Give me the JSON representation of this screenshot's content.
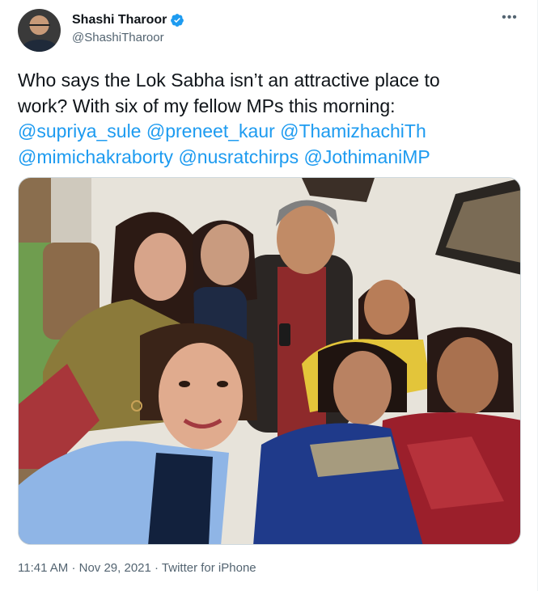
{
  "author": {
    "display_name": "Shashi Tharoor",
    "handle": "@ShashiTharoor",
    "verified": true
  },
  "tweet": {
    "text_lines": [
      "Who says the Lok Sabha isn’t an attractive place to",
      "work? With six of my fellow MPs this morning:"
    ],
    "mentions": [
      "@supriya_sule",
      "@preneet_kaur",
      "@ThamizhachiTh",
      "@mimichakraborty",
      "@nusratchirps",
      "@JothimaniMP"
    ]
  },
  "footer": {
    "time": "11:41 AM",
    "separator": "·",
    "date": "Nov 29, 2021",
    "source": "Twitter for iPhone"
  },
  "colors": {
    "link": "#1d9bf0",
    "secondary_text": "#536471",
    "verified": "#1d9bf0"
  },
  "icons": {
    "more": "more-icon",
    "verified": "verified-badge-icon"
  }
}
